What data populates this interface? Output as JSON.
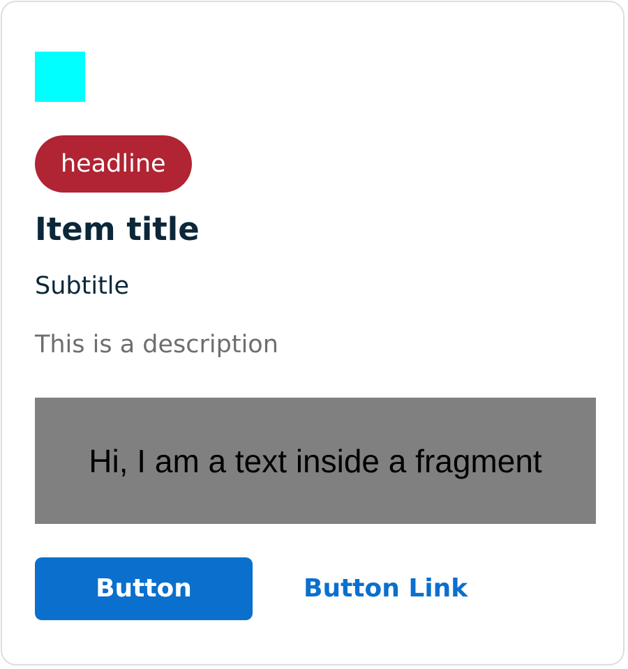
{
  "card": {
    "asset": {
      "icon": "cyan-square-asset",
      "color": "#00ffff"
    },
    "tag": {
      "label": "headline",
      "color": "#b02433"
    },
    "title": "Item title",
    "subtitle": "Subtitle",
    "description": "This is a description",
    "fragment": {
      "text": "Hi, I am a text inside a fragment",
      "background": "#808080"
    },
    "primary_button": {
      "label": "Button",
      "color": "#0b6fcd"
    },
    "link_button": {
      "label": "Button Link",
      "color": "#0b6fcd"
    }
  },
  "colors": {
    "text_primary": "#0b2739",
    "text_secondary": "#6e6e6e",
    "border": "#dddddd"
  }
}
